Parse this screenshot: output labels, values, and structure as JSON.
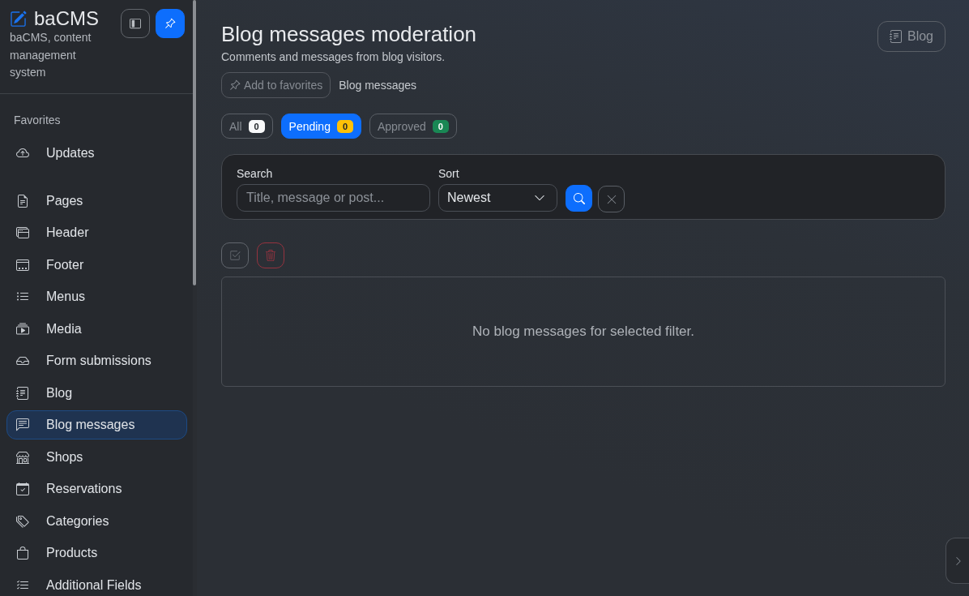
{
  "sidebar": {
    "brand": {
      "name": "baCMS",
      "tagline": "baCMS, content management system"
    },
    "pinned": true,
    "favorites": {
      "heading": "Favorites",
      "items": [
        {
          "label": "Updates",
          "selected": false
        }
      ]
    },
    "items": [
      {
        "label": "Pages",
        "selected": false
      },
      {
        "label": "Header",
        "selected": false
      },
      {
        "label": "Footer",
        "selected": false
      },
      {
        "label": "Menus",
        "selected": false
      },
      {
        "label": "Media",
        "selected": false
      },
      {
        "label": "Form submissions",
        "selected": false
      },
      {
        "label": "Blog",
        "selected": false
      },
      {
        "label": "Blog messages",
        "selected": true
      },
      {
        "label": "Shops",
        "selected": false
      },
      {
        "label": "Reservations",
        "selected": false
      },
      {
        "label": "Categories",
        "selected": false
      },
      {
        "label": "Products",
        "selected": false
      },
      {
        "label": "Additional Fields",
        "selected": false
      }
    ]
  },
  "page": {
    "title": "Blog messages moderation",
    "subtitle": "Comments and messages from blog visitors.",
    "section_button": "Blog",
    "favorite_button": "Add to favorites",
    "breadcrumb": "Blog messages"
  },
  "status_tabs": [
    {
      "label": "All",
      "count": "0",
      "color": "#f8f9fa",
      "selected": false
    },
    {
      "label": "Pending",
      "count": "0",
      "color": "#ffc107",
      "selected": true
    },
    {
      "label": "Approved",
      "count": "0",
      "color": "#198754",
      "selected": false
    }
  ],
  "filters": {
    "search": {
      "label": "Search",
      "placeholder": "Title, message or post..."
    },
    "sort": {
      "label": "Sort",
      "value": "Newest"
    }
  },
  "bulk_actions": [
    {
      "kind": "select-all",
      "disabled": true
    },
    {
      "kind": "delete",
      "disabled": true
    }
  ],
  "empty_message": "No blog messages for selected filter."
}
